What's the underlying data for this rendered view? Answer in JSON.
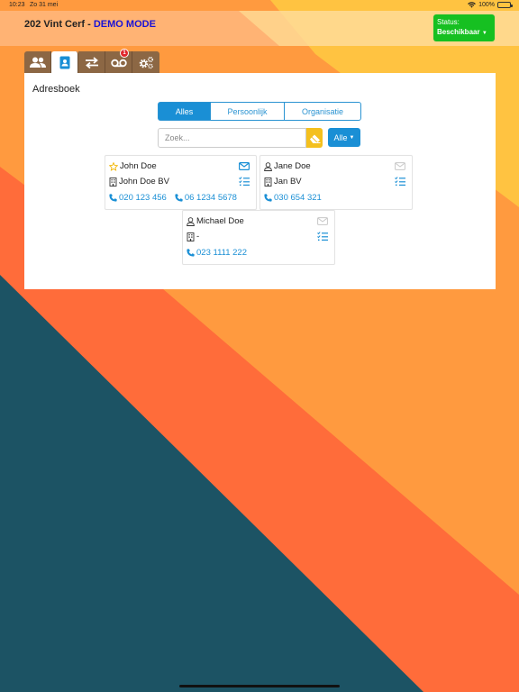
{
  "status_bar": {
    "time": "10:23",
    "date": "Zo 31 mei",
    "battery": "100%"
  },
  "header": {
    "user_name": "202 Vint Cerf",
    "separator": " - ",
    "mode": "DEMO MODE"
  },
  "status_button": {
    "label": "Status:",
    "value": "Beschikbaar"
  },
  "tabs": [
    {
      "icon": "contacts-icon"
    },
    {
      "icon": "address-book-icon",
      "active": true
    },
    {
      "icon": "transfer-icon"
    },
    {
      "icon": "voicemail-icon",
      "badge": "1"
    },
    {
      "icon": "settings-icon"
    }
  ],
  "addressbook": {
    "title": "Adresboek",
    "filters": [
      "Alles",
      "Persoonlijk",
      "Organisatie"
    ],
    "active_filter": "Alles",
    "search_placeholder": "Zoek...",
    "type_select": "Alle"
  },
  "contacts": [
    {
      "name": "John Doe",
      "company": "John Doe BV",
      "phones": [
        "020 123 456",
        "06 1234 5678"
      ],
      "favorite": true,
      "has_email": true
    },
    {
      "name": "Jane Doe",
      "company": "Jan BV",
      "phones": [
        "030 654 321"
      ],
      "favorite": false,
      "has_email": false
    },
    {
      "name": "Michael Doe",
      "company": "-",
      "phones": [
        "023 1111 222"
      ],
      "favorite": false,
      "has_email": false
    }
  ],
  "colors": {
    "accent": "#1a8fd5",
    "status_green": "#16c021",
    "tab_brown": "#8c6744",
    "clear_yellow": "#f4c01e",
    "demo_blue": "#1a12d6",
    "badge_red": "#e0262b"
  }
}
